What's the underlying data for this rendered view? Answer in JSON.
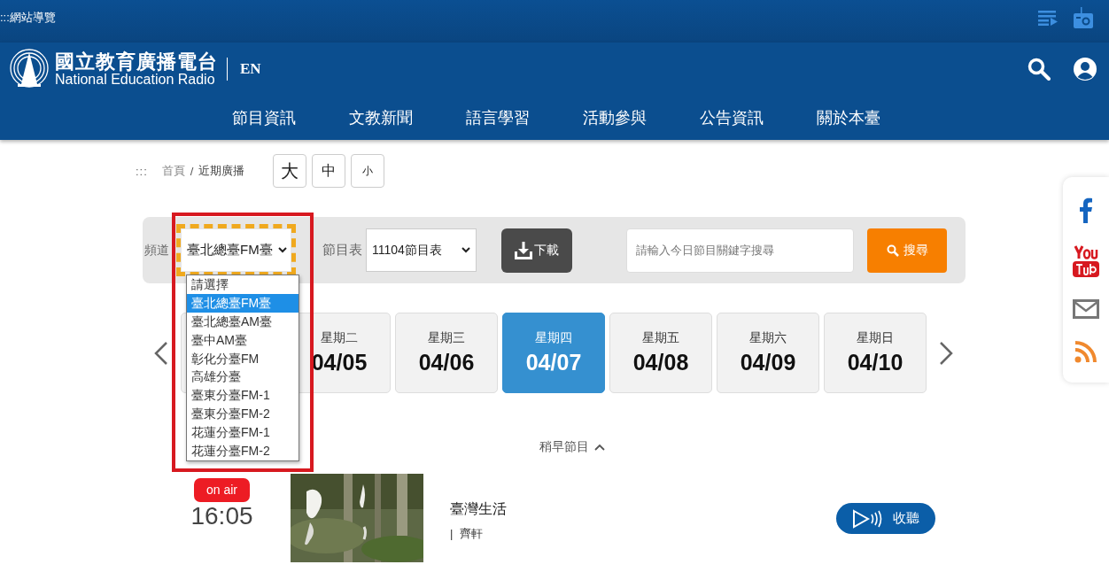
{
  "top_bar": {
    "sitemap_link": ":::網站導覽"
  },
  "header": {
    "logo_title": "國立教育廣播電台",
    "logo_subtitle": "National Education Radio",
    "language_link": "EN"
  },
  "nav": [
    "節目資訊",
    "文教新聞",
    "語言學習",
    "活動參與",
    "公告資訊",
    "關於本臺"
  ],
  "breadcrumb": {
    "marker": ":::",
    "separator": "/",
    "items": [
      "首頁",
      "近期廣播"
    ]
  },
  "font_sizes": [
    "大",
    "中",
    "小"
  ],
  "filters": {
    "channel_label": "頻道",
    "channel_value": "臺北總臺FM臺",
    "channel_options": [
      {
        "label": "請選擇",
        "selected": false
      },
      {
        "label": "臺北總臺FM臺",
        "selected": true
      },
      {
        "label": "臺北總臺AM臺",
        "selected": false
      },
      {
        "label": "臺中AM臺",
        "selected": false
      },
      {
        "label": "彰化分臺FM",
        "selected": false
      },
      {
        "label": "高雄分臺",
        "selected": false
      },
      {
        "label": "臺東分臺FM-1",
        "selected": false
      },
      {
        "label": "臺東分臺FM-2",
        "selected": false
      },
      {
        "label": "花蓮分臺FM-1",
        "selected": false
      },
      {
        "label": "花蓮分臺FM-2",
        "selected": false
      }
    ],
    "schedule_label": "節目表",
    "schedule_value": "11104節目表",
    "download_button": "下載",
    "search_placeholder": "請輸入今日節目關鍵字搜尋",
    "search_button": "搜尋"
  },
  "days": [
    {
      "selected": false
    },
    {
      "weekday": "星期二",
      "date": "04/05",
      "selected": false
    },
    {
      "weekday": "星期三",
      "date": "04/06",
      "selected": false
    },
    {
      "weekday": "星期四",
      "date": "04/07",
      "selected": true
    },
    {
      "weekday": "星期五",
      "date": "04/08",
      "selected": false
    },
    {
      "weekday": "星期六",
      "date": "04/09",
      "selected": false
    },
    {
      "weekday": "星期日",
      "date": "04/10",
      "selected": false
    }
  ],
  "earlier_link": "稍早節目",
  "programs": [
    {
      "on_air": true,
      "badge": "on air",
      "time": "16:05",
      "title": "臺灣生活",
      "host_separator": "|",
      "host": "齊軒",
      "listen_button": "收聽"
    }
  ]
}
